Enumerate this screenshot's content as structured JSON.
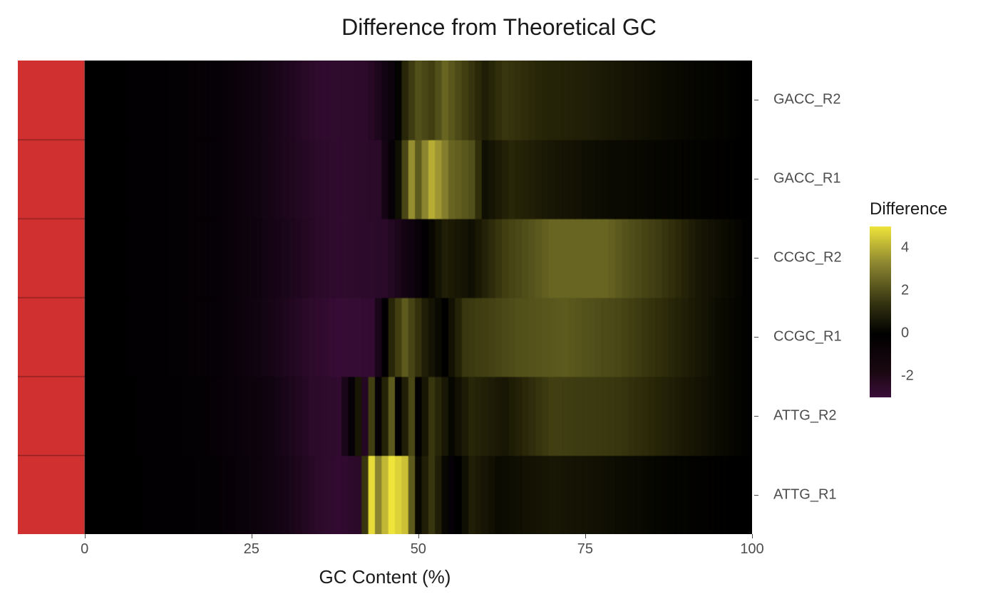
{
  "chart_data": {
    "type": "heatmap",
    "title": "Difference from Theoretical GC",
    "xlabel": "GC Content (%)",
    "ylabel": "",
    "xlim": [
      -10,
      100
    ],
    "x_ticks": [
      0,
      25,
      50,
      75,
      100
    ],
    "categories": [
      "ATTG_R1",
      "ATTG_R2",
      "CCGC_R1",
      "CCGC_R2",
      "GACC_R1",
      "GACC_R2"
    ],
    "legend_title": "Difference",
    "legend_range": [
      -3,
      5
    ],
    "legend_ticks": [
      -2,
      0,
      2,
      4
    ],
    "sidebar_color": "#d03030",
    "colorscale": [
      [
        -3,
        "#3a0d3a"
      ],
      [
        -2,
        "#2a0a28"
      ],
      [
        -1,
        "#100410"
      ],
      [
        0,
        "#000000"
      ],
      [
        1,
        "#282608"
      ],
      [
        2,
        "#52501a"
      ],
      [
        3,
        "#8b8530"
      ],
      [
        4,
        "#c2b836"
      ],
      [
        5,
        "#efe43a"
      ]
    ],
    "series": [
      {
        "name": "ATTG_R1",
        "control_points": [
          [
            0,
            0
          ],
          [
            20,
            -0.3
          ],
          [
            30,
            -1.2
          ],
          [
            38,
            -2.6
          ],
          [
            41,
            -2.0
          ],
          [
            43,
            4.8
          ],
          [
            44,
            3.0
          ],
          [
            46,
            5.0
          ],
          [
            48,
            4.2
          ],
          [
            50,
            0.2
          ],
          [
            52,
            1.4
          ],
          [
            55,
            -0.4
          ],
          [
            58,
            0.8
          ],
          [
            62,
            0.3
          ],
          [
            70,
            0.6
          ],
          [
            78,
            0.4
          ],
          [
            88,
            0.1
          ],
          [
            100,
            0.0
          ]
        ]
      },
      {
        "name": "ATTG_R2",
        "control_points": [
          [
            0,
            0
          ],
          [
            18,
            -0.3
          ],
          [
            28,
            -1.0
          ],
          [
            34,
            -2.0
          ],
          [
            38,
            -2.4
          ],
          [
            41,
            0.6
          ],
          [
            42,
            -1.8
          ],
          [
            43,
            1.6
          ],
          [
            44,
            -0.4
          ],
          [
            46,
            2.2
          ],
          [
            47,
            -0.2
          ],
          [
            49,
            1.8
          ],
          [
            50,
            -0.2
          ],
          [
            52,
            1.4
          ],
          [
            55,
            0.2
          ],
          [
            58,
            1.0
          ],
          [
            63,
            0.6
          ],
          [
            70,
            1.6
          ],
          [
            80,
            1.4
          ],
          [
            88,
            0.8
          ],
          [
            95,
            0.3
          ],
          [
            100,
            0.0
          ]
        ]
      },
      {
        "name": "CCGC_R1",
        "control_points": [
          [
            0,
            0
          ],
          [
            20,
            -0.4
          ],
          [
            30,
            -1.5
          ],
          [
            38,
            -2.8
          ],
          [
            43,
            -2.6
          ],
          [
            46,
            1.0
          ],
          [
            48,
            2.2
          ],
          [
            51,
            0.8
          ],
          [
            54,
            0.0
          ],
          [
            57,
            1.4
          ],
          [
            60,
            1.6
          ],
          [
            65,
            2.0
          ],
          [
            72,
            2.2
          ],
          [
            80,
            1.8
          ],
          [
            88,
            1.0
          ],
          [
            95,
            0.3
          ],
          [
            100,
            0.0
          ]
        ]
      },
      {
        "name": "CCGC_R2",
        "control_points": [
          [
            0,
            0
          ],
          [
            20,
            -0.4
          ],
          [
            30,
            -1.4
          ],
          [
            38,
            -2.4
          ],
          [
            45,
            -2.0
          ],
          [
            50,
            -0.6
          ],
          [
            52,
            0.2
          ],
          [
            54,
            0.8
          ],
          [
            58,
            0.4
          ],
          [
            63,
            1.6
          ],
          [
            70,
            2.4
          ],
          [
            78,
            2.4
          ],
          [
            86,
            1.5
          ],
          [
            92,
            0.6
          ],
          [
            100,
            0.0
          ]
        ]
      },
      {
        "name": "GACC_R1",
        "control_points": [
          [
            0,
            0
          ],
          [
            20,
            -0.4
          ],
          [
            30,
            -1.5
          ],
          [
            38,
            -2.4
          ],
          [
            44,
            -2.0
          ],
          [
            47,
            0.4
          ],
          [
            49,
            3.2
          ],
          [
            50,
            2.2
          ],
          [
            52,
            3.8
          ],
          [
            55,
            2.4
          ],
          [
            58,
            2.0
          ],
          [
            60,
            0.4
          ],
          [
            64,
            1.0
          ],
          [
            70,
            0.6
          ],
          [
            78,
            0.3
          ],
          [
            90,
            0.1
          ],
          [
            100,
            0.0
          ]
        ]
      },
      {
        "name": "GACC_R2",
        "control_points": [
          [
            0,
            0
          ],
          [
            20,
            -0.4
          ],
          [
            30,
            -1.5
          ],
          [
            36,
            -2.4
          ],
          [
            42,
            -2.2
          ],
          [
            46,
            -0.8
          ],
          [
            48,
            1.0
          ],
          [
            50,
            2.0
          ],
          [
            52,
            1.6
          ],
          [
            54,
            2.4
          ],
          [
            57,
            1.6
          ],
          [
            60,
            0.8
          ],
          [
            63,
            1.4
          ],
          [
            68,
            1.0
          ],
          [
            75,
            0.8
          ],
          [
            82,
            0.5
          ],
          [
            90,
            0.2
          ],
          [
            100,
            0.0
          ]
        ]
      }
    ]
  }
}
